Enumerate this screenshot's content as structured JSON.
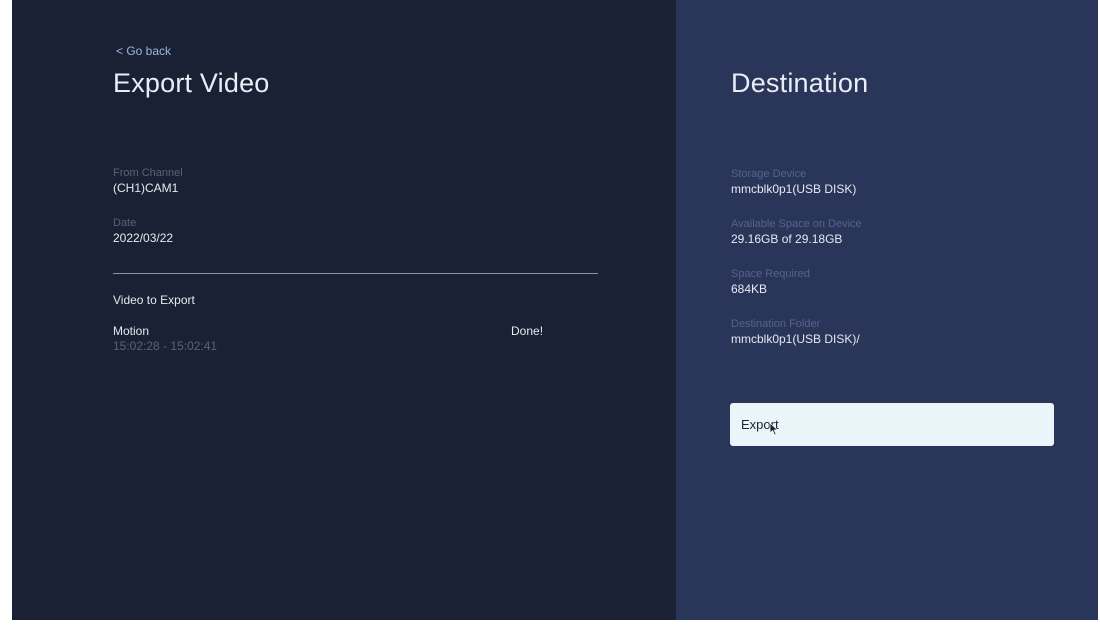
{
  "header": {
    "back_link": "< Go back",
    "title": "Export Video"
  },
  "source": {
    "channel": {
      "label": "From Channel",
      "value": "(CH1)CAM1"
    },
    "date": {
      "label": "Date",
      "value": "2022/03/22"
    }
  },
  "export_list": {
    "heading": "Video to Export",
    "items": [
      {
        "type": "Motion",
        "time_range": "15:02:28 - 15:02:41",
        "status": "Done!"
      }
    ]
  },
  "destination": {
    "title": "Destination",
    "storage_device": {
      "label": "Storage Device",
      "value": "mmcblk0p1(USB DISK)"
    },
    "available_space": {
      "label": "Available Space on Device",
      "value": "29.16GB of 29.18GB"
    },
    "space_required": {
      "label": "Space Required",
      "value": "684KB"
    },
    "destination_folder": {
      "label": "Destination Folder",
      "value": "mmcblk0p1(USB DISK)/"
    },
    "export_button_label": "Export"
  },
  "icons": {
    "cursor": "mouse-pointer-icon"
  },
  "colors": {
    "left_panel_bg": "#1b2134",
    "right_panel_bg": "#2a3659",
    "button_bg": "#e9f5f8",
    "link": "#9db4e0"
  }
}
